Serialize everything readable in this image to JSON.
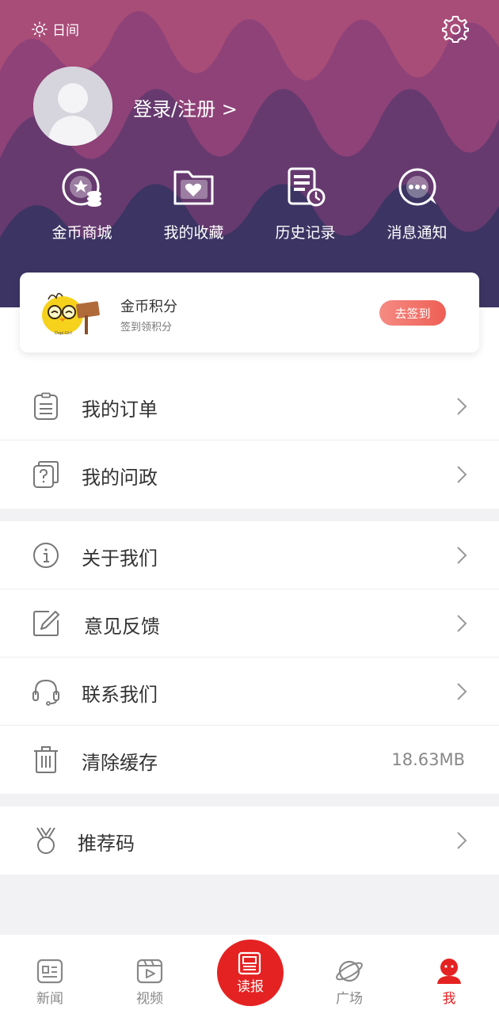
{
  "header": {
    "mode_label": "日间",
    "login_label": "登录/注册 >",
    "quick_actions": [
      {
        "label": "金币商城",
        "icon": "coin-mall-icon"
      },
      {
        "label": "我的收藏",
        "icon": "favorites-folder-icon"
      },
      {
        "label": "历史记录",
        "icon": "history-icon"
      },
      {
        "label": "消息通知",
        "icon": "message-icon"
      }
    ],
    "colors": {
      "wave_top": "#a84c78",
      "wave_mid": "#7e3d75",
      "wave_bottom": "#3a3563"
    }
  },
  "points_card": {
    "title": "金币积分",
    "subtitle": "签到领积分",
    "button_label": "去签到"
  },
  "menu_group_1": [
    {
      "label": "我的订单",
      "icon": "order-list-icon"
    },
    {
      "label": "我的问政",
      "icon": "question-doc-icon"
    }
  ],
  "menu_group_2": [
    {
      "label": "关于我们",
      "icon": "info-icon"
    },
    {
      "label": "意见反馈",
      "icon": "edit-feedback-icon"
    },
    {
      "label": "联系我们",
      "icon": "headset-icon"
    },
    {
      "label": "清除缓存",
      "icon": "trash-icon",
      "value": "18.63MB"
    }
  ],
  "menu_group_3": [
    {
      "label": "推荐码",
      "icon": "medal-icon"
    }
  ],
  "tabbar": {
    "tabs": [
      {
        "label": "新闻",
        "icon": "news-icon"
      },
      {
        "label": "视频",
        "icon": "video-icon"
      },
      {
        "label": "读报",
        "icon": "newspaper-icon"
      },
      {
        "label": "广场",
        "icon": "planet-icon"
      },
      {
        "label": "我",
        "icon": "user-icon"
      }
    ],
    "active_color": "#e52222"
  }
}
